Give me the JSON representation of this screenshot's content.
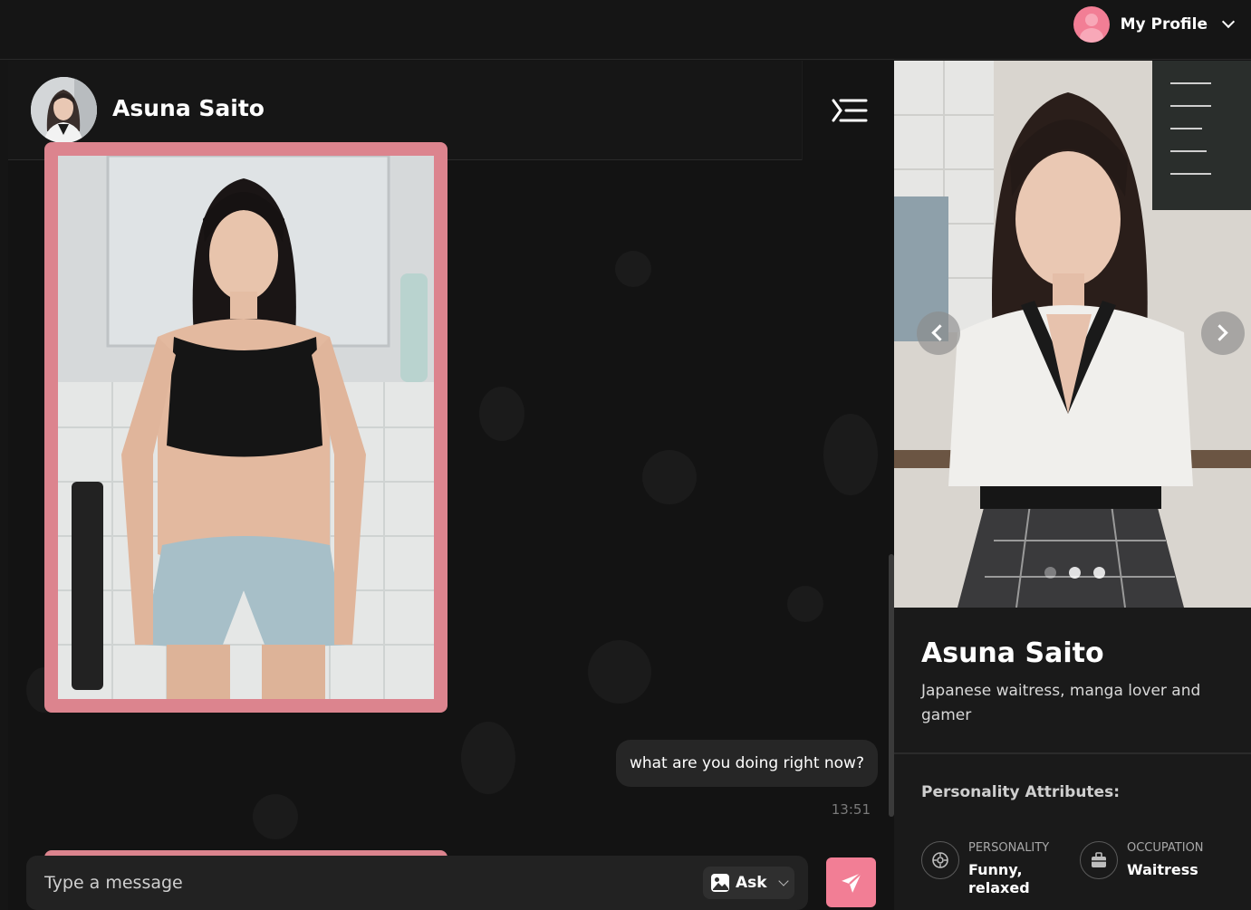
{
  "topbar": {
    "profile_label": "My Profile"
  },
  "chat": {
    "title": "Asuna Saito",
    "messages": [
      {
        "type": "image",
        "side": "left"
      },
      {
        "type": "text",
        "side": "right",
        "text": "what are you doing right now?",
        "time": "13:51"
      },
      {
        "type": "image",
        "side": "left"
      }
    ],
    "composer": {
      "placeholder": "Type a message",
      "ask_label": "Ask"
    },
    "colors": {
      "accent": "#f27e95",
      "image_frame": "#dc848e"
    }
  },
  "profile": {
    "name": "Asuna Saito",
    "description": "Japanese waitress, manga lover and gamer",
    "attributes_title": "Personality Attributes:",
    "attributes": [
      {
        "label": "PERSONALITY",
        "value": "Funny, relaxed",
        "icon": "personality-icon"
      },
      {
        "label": "OCCUPATION",
        "value": "Waitress",
        "icon": "briefcase-icon"
      }
    ],
    "carousel": {
      "slides": 3,
      "active_index": 1
    }
  }
}
